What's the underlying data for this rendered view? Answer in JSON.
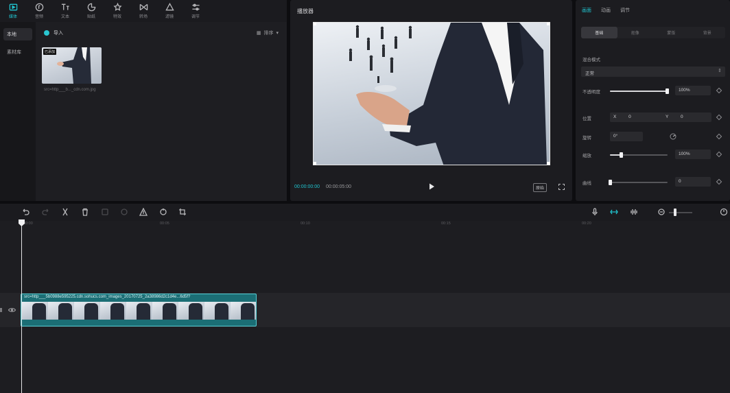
{
  "toolbar": {
    "items": [
      {
        "icon": "media-icon",
        "label": "媒体",
        "active": true
      },
      {
        "icon": "audio-icon",
        "label": "音频"
      },
      {
        "icon": "text-icon",
        "label": "文本"
      },
      {
        "icon": "sticker-icon",
        "label": "贴纸"
      },
      {
        "icon": "effects-icon",
        "label": "特效"
      },
      {
        "icon": "transition-icon",
        "label": "转场"
      },
      {
        "icon": "filter-icon",
        "label": "滤镜"
      },
      {
        "icon": "adjust-icon",
        "label": "调节"
      }
    ]
  },
  "media_nav": {
    "items": [
      "本地",
      "素材库"
    ]
  },
  "media": {
    "import_label": "导入",
    "sort_label": "排序",
    "clip_badge": "已添加",
    "clip_name": "src=http___b..._cdn.com.jpg"
  },
  "player": {
    "title": "播放器",
    "current_time": "00:00:00:00",
    "total_time": "00:00:05:00",
    "ratio_label": "原始"
  },
  "properties": {
    "tabs": [
      "画面",
      "动画",
      "调节"
    ],
    "sub_tabs": [
      "基础",
      "抠像",
      "蒙版",
      "背景"
    ],
    "blend_label": "混合模式",
    "blend_value": "正常",
    "opacity_label": "不透明度",
    "opacity_value": "100%",
    "opacity_level": 1.0,
    "position_label": "位置",
    "pos_x_label": "X",
    "pos_x": "0",
    "pos_y_label": "Y",
    "pos_y": "0",
    "rotate_label": "旋转",
    "rotate_value": "0°",
    "scale_label": "缩放",
    "scale_value": "100%",
    "scale_level": 0.2,
    "next_label": "曲线",
    "next_value": "0"
  },
  "timeline": {
    "ticks": [
      "00:00",
      "00:05",
      "00:10",
      "00:15",
      "00:20"
    ],
    "clip_label": "src=http___5b0988e595225.cdn.sohucs.com_images_20170725_2a38986d2c1d4e...6d5f?"
  },
  "colors": {
    "accent": "#20c4cf",
    "clip": "#1b6e75"
  }
}
